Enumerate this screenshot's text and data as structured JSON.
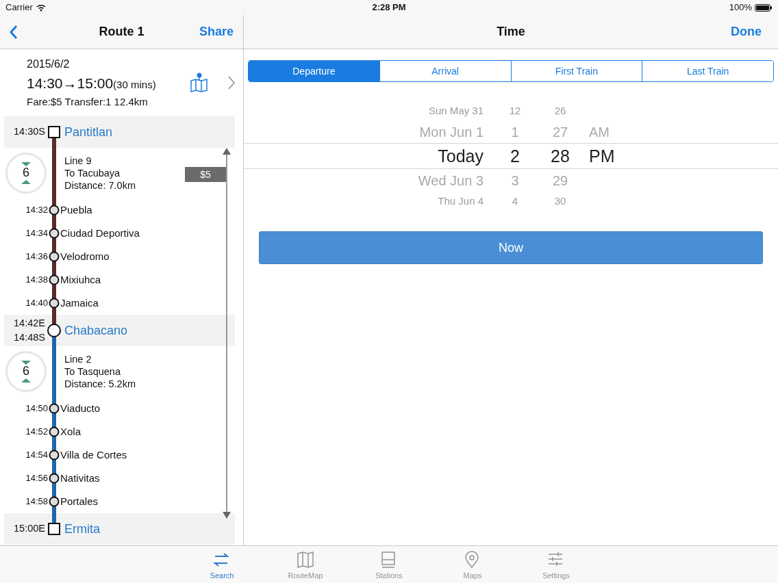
{
  "status_bar": {
    "carrier": "Carrier",
    "time": "2:28 PM",
    "battery": "100%"
  },
  "left_nav": {
    "title": "Route 1",
    "action": "Share"
  },
  "right_nav": {
    "title": "Time",
    "action": "Done"
  },
  "summary": {
    "date": "2015/6/2",
    "times": "14:30→15:00",
    "duration": "(30 mins)",
    "details": "Fare:$5 Transfer:1 12.4km"
  },
  "route": [
    {
      "kind": "terminal",
      "times": [
        "14:30S"
      ],
      "name": "Pantitlan"
    },
    {
      "kind": "line",
      "color": "#5b2b28",
      "count": "6",
      "name": "Line 9",
      "direction": "To Tacubaya",
      "distance": "Distance: 7.0km",
      "stops": [
        {
          "time": "14:32",
          "name": "Puebla"
        },
        {
          "time": "14:34",
          "name": "Ciudad Deportiva"
        },
        {
          "time": "14:36",
          "name": "Velodromo"
        },
        {
          "time": "14:38",
          "name": "Mixiuhca"
        },
        {
          "time": "14:40",
          "name": "Jamaica"
        }
      ]
    },
    {
      "kind": "transfer",
      "times": [
        "14:42E",
        "14:48S"
      ],
      "name": "Chabacano"
    },
    {
      "kind": "line",
      "color": "#1f67a8",
      "count": "6",
      "name": "Line 2",
      "direction": "To Tasquena",
      "distance": "Distance: 5.2km",
      "stops": [
        {
          "time": "14:50",
          "name": "Viaducto"
        },
        {
          "time": "14:52",
          "name": "Xola"
        },
        {
          "time": "14:54",
          "name": "Villa de Cortes"
        },
        {
          "time": "14:56",
          "name": "Nativitas"
        },
        {
          "time": "14:58",
          "name": "Portales"
        }
      ]
    },
    {
      "kind": "terminal",
      "times": [
        "15:00E"
      ],
      "name": "Ermita"
    }
  ],
  "fare_marker": {
    "label": "$5"
  },
  "segments": [
    {
      "label": "Departure",
      "selected": true
    },
    {
      "label": "Arrival",
      "selected": false
    },
    {
      "label": "First Train",
      "selected": false
    },
    {
      "label": "Last Train",
      "selected": false
    }
  ],
  "picker": [
    {
      "date": "Sun May 31",
      "hour": "12",
      "minute": "26",
      "selected": false
    },
    {
      "date": "Mon Jun 1",
      "hour": "1",
      "minute": "27",
      "ampm": "AM",
      "selected": false
    },
    {
      "date": "Today",
      "hour": "2",
      "minute": "28",
      "ampm": "PM",
      "selected": true
    },
    {
      "date": "Wed Jun 3",
      "hour": "3",
      "minute": "29",
      "selected": false
    },
    {
      "date": "Thu Jun 4",
      "hour": "4",
      "minute": "30",
      "selected": false
    }
  ],
  "now_button": "Now",
  "tab_bar": [
    {
      "label": "Search",
      "selected": true
    },
    {
      "label": "RouteMap",
      "selected": false
    },
    {
      "label": "Stations",
      "selected": false
    },
    {
      "label": "Maps",
      "selected": false
    },
    {
      "label": "Settings",
      "selected": false
    }
  ]
}
